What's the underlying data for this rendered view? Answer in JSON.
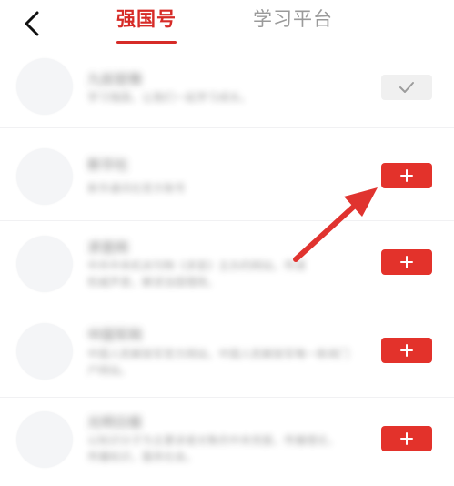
{
  "header": {
    "back_icon": "chevron-left-icon",
    "tabs": [
      {
        "label": "强国号",
        "active": true
      },
      {
        "label": "学习平台",
        "active": false
      }
    ]
  },
  "colors": {
    "accent": "#d62b27",
    "follow_button": "#e3322b",
    "followed_button": "#f0f0f0",
    "inactive_tab": "#9a9a9a",
    "annotation_arrow": "#e0332f"
  },
  "accounts": [
    {
      "name": "九如官微",
      "desc": "学习强国，让我们一起学习成长。",
      "desc2": "",
      "status": "followed",
      "button_icon": "check-icon"
    },
    {
      "name": "新华社",
      "desc": "新华通讯社官方账号",
      "desc2": "",
      "status": "follow",
      "button_icon": "plus-icon"
    },
    {
      "name": "求是网",
      "desc": "中共中央机关刊物《求是》主办的网站，传递",
      "desc2": "权威声音，解读治国理政。",
      "status": "follow",
      "button_icon": "plus-icon"
    },
    {
      "name": "中国军网",
      "desc": "中国人民解放军官方网站，中国人民解放军唯一新闻门",
      "desc2": "户网站。",
      "status": "follow",
      "button_icon": "plus-icon"
    },
    {
      "name": "光明日报",
      "desc": "以知识分子为主要读者对象的中央党报，传播理论，",
      "desc2": "传播知识，服务社会。",
      "status": "follow",
      "button_icon": "plus-icon"
    }
  ],
  "annotation": {
    "icon": "red-arrow-icon"
  }
}
